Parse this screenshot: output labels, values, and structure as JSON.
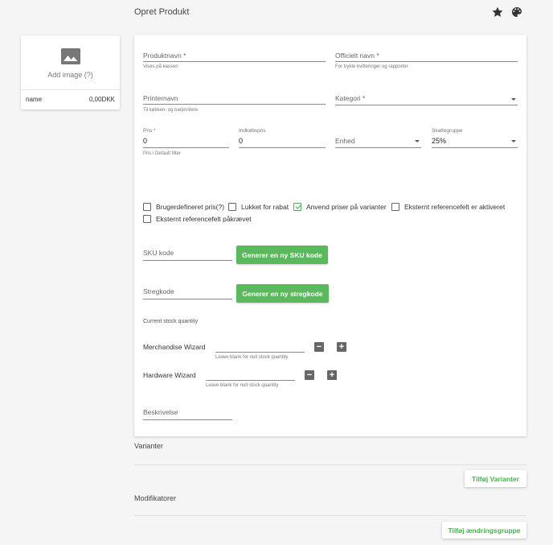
{
  "header": {
    "title": "Opret Produkt",
    "icons": [
      "star-icon",
      "palette-icon"
    ]
  },
  "image_card": {
    "add_label": "Add image (?)",
    "name": "name",
    "price": "0,00DKK"
  },
  "form": {
    "produktnavn": {
      "label": "Produktnavn *",
      "value": "",
      "hint": "Vises på kassen"
    },
    "officielt_navn": {
      "label": "Officielt navn *",
      "value": "",
      "hint": "For trykte kvitteringer og rapporter"
    },
    "printernavn": {
      "label": "Printernavn",
      "value": "",
      "hint": "Til køkken- og barprintere"
    },
    "kategori": {
      "label": "Kategori *",
      "value": ""
    },
    "pris": {
      "label": "Pris *",
      "value": "0",
      "hint": "Pris i Default filter"
    },
    "indkobspris": {
      "label": "Indkøbspris",
      "value": "0"
    },
    "enhed": {
      "label": "Enhed",
      "value": ""
    },
    "skattegruppe": {
      "label": "Skattegruppe",
      "value": "25%"
    },
    "checkboxes": [
      {
        "label": "Brugerdefineret pris(?)",
        "checked": false
      },
      {
        "label": "Lukket for rabat",
        "checked": false
      },
      {
        "label": "Anvend priser på varianter",
        "checked": true
      },
      {
        "label": "Eksternt referencefelt er aktiveret",
        "checked": false
      },
      {
        "label": "Eksternt referencefelt påkrævet",
        "checked": false
      }
    ],
    "sku": {
      "label": "SKU kode",
      "value": "",
      "button": "Generer en ny SKU kode"
    },
    "stregkode": {
      "label": "Stregkode",
      "value": "",
      "button": "Generer en ny stregkode"
    },
    "stock": {
      "title": "Current stock quantity",
      "rows": [
        {
          "name": "Merchandise Wizard",
          "value": "",
          "hint": "Leave blank for null stock quantity"
        },
        {
          "name": "Hardware Wizard",
          "value": "",
          "hint": "Leave blank for null stock quantity"
        }
      ]
    },
    "beskrivelse": {
      "label": "Beskrivelse",
      "value": ""
    }
  },
  "varianter": {
    "title": "Varianter",
    "button": "Tilføj Varianter"
  },
  "modifikatorer": {
    "title": "Modifikatorer",
    "button": "Tilføj ændringsgruppe"
  }
}
